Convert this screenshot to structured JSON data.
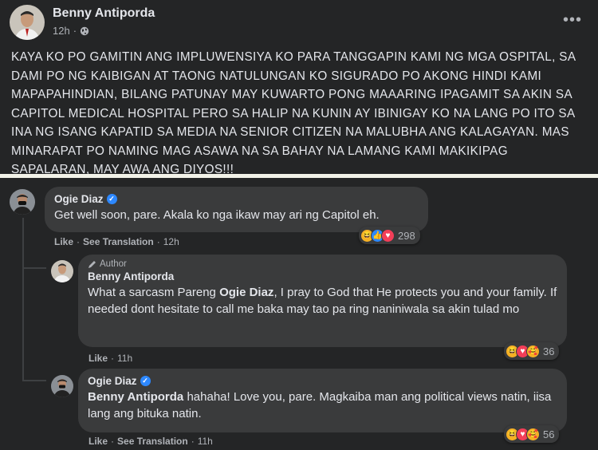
{
  "post": {
    "author": "Benny Antiporda",
    "time": "12h",
    "privacy_icon": "globe-icon",
    "more_label": "•••",
    "body": "KAYA KO PO GAMITIN ANG IMPLUWENSIYA KO PARA TANGGAPIN KAMI NG MGA OSPITAL, SA DAMI PO NG KAIBIGAN AT TAONG NATULUNGAN KO SIGURADO PO AKONG HINDI KAMI MAPAPAHINDIAN, BILANG PATUNAY MAY KUWARTO PONG MAAARING IPAGAMIT SA AKIN SA CAPITOL MEDICAL HOSPITAL PERO SA HALIP NA KUNIN AY IBINIGAY KO NA LANG PO ITO SA INA NG ISANG KAPATID SA MEDIA NA SENIOR CITIZEN NA MALUBHA ANG KALAGAYAN. MAS MINARAPAT PO NAMING MAG ASAWA NA SA BAHAY NA LAMANG KAMI MAKIKIPAG SAPALARAN, MAY AWA ANG DIYOS!!!"
  },
  "comments": [
    {
      "name": "Ogie Diaz",
      "verified": true,
      "text": "Get well soon, pare. Akala ko nga ikaw may ari ng Capitol eh.",
      "like": "Like",
      "see_translation": "See Translation",
      "time": "12h",
      "reaction_count": "298"
    }
  ],
  "replies": [
    {
      "author_tag": "Author",
      "name": "Benny Antiporda",
      "text_before": "What a sarcasm Pareng ",
      "mention": "Ogie Diaz",
      "text_after": ", I pray to God that He protects you and your family. If needed dont hesitate to call me baka may tao pa ring naniniwala sa akin tulad mo",
      "like": "Like",
      "time": "11h",
      "reaction_count": "36"
    },
    {
      "name": "Ogie Diaz",
      "verified": true,
      "mention": "Benny Antiporda",
      "text_after": " hahaha! Love you, pare. Magkaiba man ang political views natin, iisa lang ang bituka natin.",
      "like": "Like",
      "see_translation": "See Translation",
      "time": "11h",
      "reaction_count": "56"
    }
  ],
  "colors": {
    "background": "#242526",
    "bubble": "#3a3b3c",
    "text": "#e4e6eb",
    "secondary": "#b0b3b8",
    "verified": "#2d88ff"
  }
}
